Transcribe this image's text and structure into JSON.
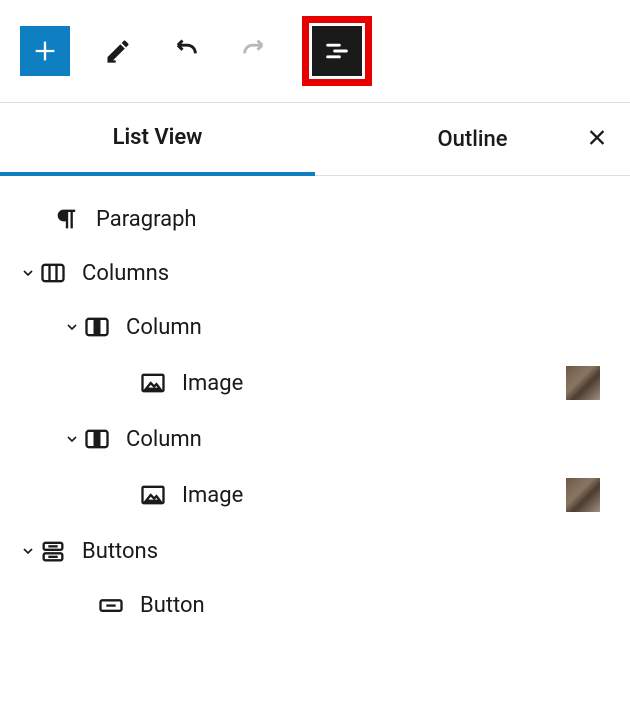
{
  "toolbar": {
    "add": "Add block",
    "edit": "Edit",
    "undo": "Undo",
    "redo": "Redo",
    "outline": "Document Outline"
  },
  "tabs": {
    "listView": "List View",
    "outline": "Outline",
    "close": "Close"
  },
  "tree": [
    {
      "label": "Paragraph",
      "icon": "paragraph",
      "indent": 0,
      "chevron": false,
      "thumb": false
    },
    {
      "label": "Columns",
      "icon": "columns",
      "indent": 1,
      "chevron": true,
      "thumb": false
    },
    {
      "label": "Column",
      "icon": "column",
      "indent": 2,
      "chevron": true,
      "thumb": false
    },
    {
      "label": "Image",
      "icon": "image",
      "indent": 3,
      "chevron": false,
      "thumb": true
    },
    {
      "label": "Column",
      "icon": "column",
      "indent": 2,
      "chevron": true,
      "thumb": false
    },
    {
      "label": "Image",
      "icon": "image",
      "indent": 3,
      "chevron": false,
      "thumb": true
    },
    {
      "label": "Buttons",
      "icon": "buttons",
      "indent": 1,
      "chevron": true,
      "thumb": false
    },
    {
      "label": "Button",
      "icon": "button",
      "indent": 4,
      "chevron": false,
      "thumb": false
    }
  ]
}
